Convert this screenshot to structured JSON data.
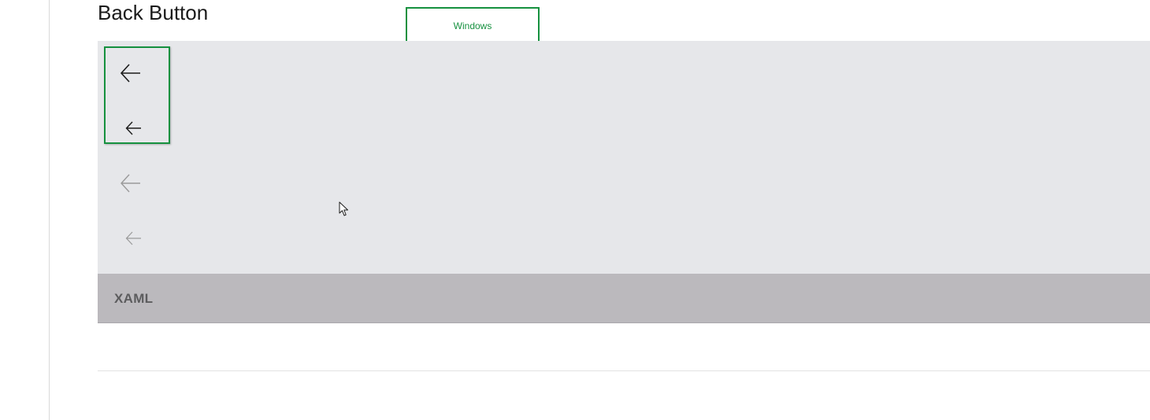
{
  "section": {
    "title": "Back Button"
  },
  "platform_tag": {
    "label": "Windows",
    "color": "#16913f"
  },
  "demo": {
    "buttons": [
      {
        "name": "back-button-normal",
        "icon": "arrow-left-icon",
        "state": "enabled",
        "size": "normal"
      },
      {
        "name": "back-button-small",
        "icon": "arrow-left-icon",
        "state": "enabled",
        "size": "small"
      },
      {
        "name": "back-button-normal-disabled",
        "icon": "arrow-left-icon",
        "state": "disabled",
        "size": "normal"
      },
      {
        "name": "back-button-small-disabled",
        "icon": "arrow-left-icon",
        "state": "disabled",
        "size": "small"
      }
    ],
    "enabled_color": "#1b1b1b",
    "disabled_color": "#9a9a9a",
    "panel_color": "#e6e7ea",
    "highlight_color": "#16913f"
  },
  "code_tab": {
    "label": "XAML",
    "background": "#bbb9bd"
  }
}
